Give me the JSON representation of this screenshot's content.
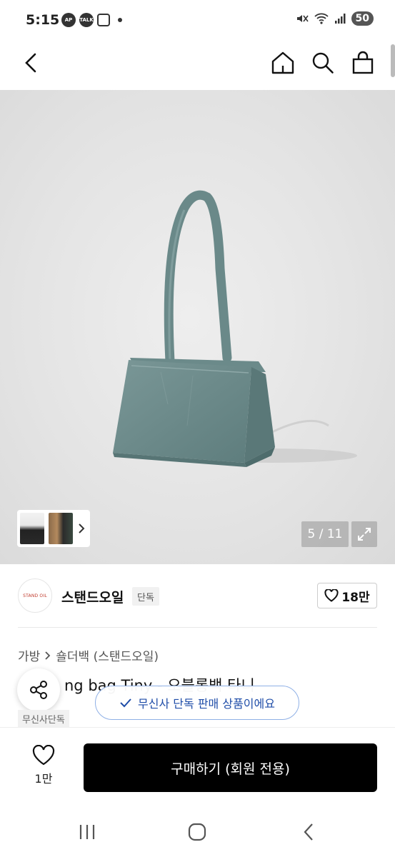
{
  "status_bar": {
    "time": "5:15",
    "battery": "50",
    "left_icons": [
      "AP",
      "TALK"
    ]
  },
  "app_bar": {
    "icons": [
      "back-icon",
      "home-icon",
      "search-icon",
      "cart-icon"
    ]
  },
  "gallery": {
    "counter": "5 / 11",
    "product_color": "#6f8f8f"
  },
  "brand": {
    "logo_text": "STAND OIL",
    "name": "스탠드오일",
    "badge": "단독",
    "likes": "18만"
  },
  "product": {
    "category_1": "가방",
    "category_2": "숄더백 (스탠드오일)",
    "title": "ng bag Tiny - 오블롱백 타니",
    "exclusive_tag": "무신사단독"
  },
  "toast": {
    "message": "무신사 단독 판매 상품이에요"
  },
  "bottom_bar": {
    "wish_count": "1만",
    "buy_label": "구매하기 (회원 전용)"
  },
  "colors": {
    "toast_text": "#1f4da8",
    "toast_border": "#8fb0e6",
    "buy_button": "#000000"
  }
}
